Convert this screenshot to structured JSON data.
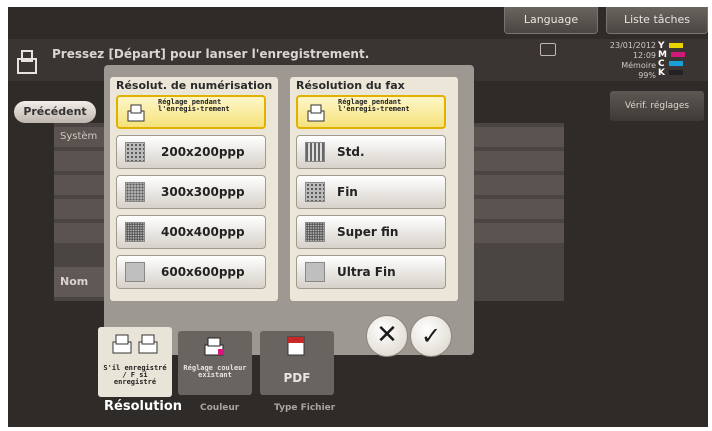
{
  "header": {
    "language_btn": "Language",
    "jobs_btn": "Liste tâches"
  },
  "status": {
    "message": "Pressez [Départ] pour lanser l'enregistrement.",
    "date": "23/01/2012",
    "time": "12:09",
    "memory_label": "Mémoire",
    "memory_value": "99%",
    "ink_labels": [
      "Y",
      "M",
      "C",
      "K"
    ],
    "ink_colors": [
      "#e8d200",
      "#d4187a",
      "#1aa0d8",
      "#222222"
    ]
  },
  "side": {
    "verif_btn": "Vérif. réglages",
    "precedent_btn": "Précédent"
  },
  "background": {
    "system_label": "Systèm",
    "nom_label": "Nom"
  },
  "popup": {
    "scan_title": "Résolut. de numérisation",
    "fax_title": "Résolution du fax",
    "scan_options": [
      {
        "label": "Réglage pendant l'enregis-trement",
        "selected": true
      },
      {
        "label": "200x200ppp",
        "selected": false
      },
      {
        "label": "300x300ppp",
        "selected": false
      },
      {
        "label": "400x400ppp",
        "selected": false
      },
      {
        "label": "600x600ppp",
        "selected": false
      }
    ],
    "fax_options": [
      {
        "label": "Réglage pendant l'enregis-trement",
        "selected": true
      },
      {
        "label": "Std.",
        "selected": false
      },
      {
        "label": "Fin",
        "selected": false
      },
      {
        "label": "Super fin",
        "selected": false
      },
      {
        "label": "Ultra Fin",
        "selected": false
      }
    ],
    "cancel_symbol": "✕",
    "ok_symbol": "✓"
  },
  "tabs": [
    {
      "small": "S'il enregistré / F si enregistré",
      "caption": "Résolution",
      "active": true
    },
    {
      "small": "Réglage couleur existant",
      "caption": "Couleur",
      "active": false
    },
    {
      "small": "PDF",
      "caption": "Type Fichier",
      "active": false
    }
  ]
}
